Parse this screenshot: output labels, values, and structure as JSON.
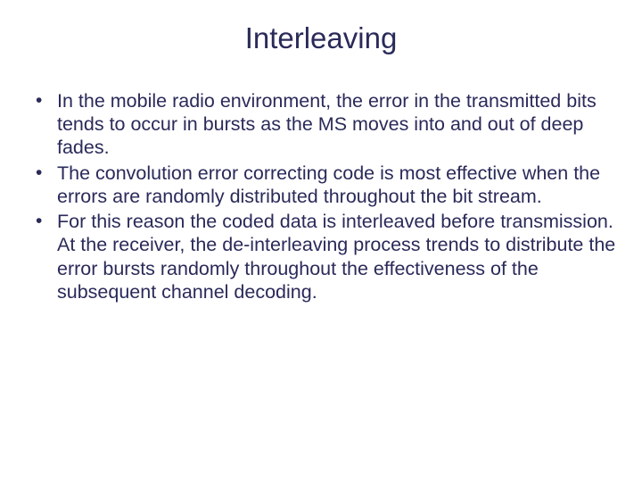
{
  "slide": {
    "title": "Interleaving",
    "bullets": [
      "In the mobile radio environment, the error in the transmitted bits tends to occur in bursts as the MS moves into and out of deep fades.",
      "The convolution error correcting code is most effective when the errors are randomly distributed throughout the bit stream.",
      "For this reason the coded data is interleaved before transmission. At the receiver, the de-interleaving process trends to distribute the error bursts randomly throughout the effectiveness of the subsequent channel decoding."
    ]
  }
}
